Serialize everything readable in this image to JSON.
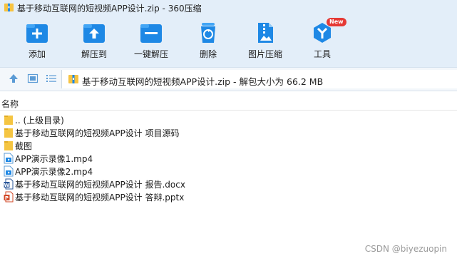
{
  "window": {
    "title": "基于移动互联网的短视频APP设计.zip - 360压缩"
  },
  "toolbar": {
    "items": [
      {
        "label": "添加",
        "icon": "add-icon"
      },
      {
        "label": "解压到",
        "icon": "extract-to-icon"
      },
      {
        "label": "一键解压",
        "icon": "one-click-extract-icon"
      },
      {
        "label": "删除",
        "icon": "delete-icon"
      },
      {
        "label": "图片压缩",
        "icon": "image-compress-icon"
      },
      {
        "label": "工具",
        "icon": "tools-icon",
        "badge": "New"
      }
    ]
  },
  "address": {
    "path": "基于移动互联网的短视频APP设计.zip - 解包大小为 66.2 MB"
  },
  "list": {
    "column_name": "名称",
    "files": [
      {
        "name": ".. (上级目录)",
        "type": "folder"
      },
      {
        "name": "基于移动互联网的短视频APP设计 项目源码",
        "type": "folder"
      },
      {
        "name": "截图",
        "type": "folder"
      },
      {
        "name": "APP演示录像1.mp4",
        "type": "video"
      },
      {
        "name": "APP演示录像2.mp4",
        "type": "video"
      },
      {
        "name": "基于移动互联网的短视频APP设计 报告.docx",
        "type": "docx"
      },
      {
        "name": "基于移动互联网的短视频APP设计 答辩.pptx",
        "type": "pptx"
      }
    ]
  },
  "watermark": "CSDN @biyezuopin",
  "colors": {
    "accent": "#1e88e5",
    "toolbar_bg": "#e3eef9",
    "folder": "#f5c542",
    "badge": "#e53935"
  }
}
